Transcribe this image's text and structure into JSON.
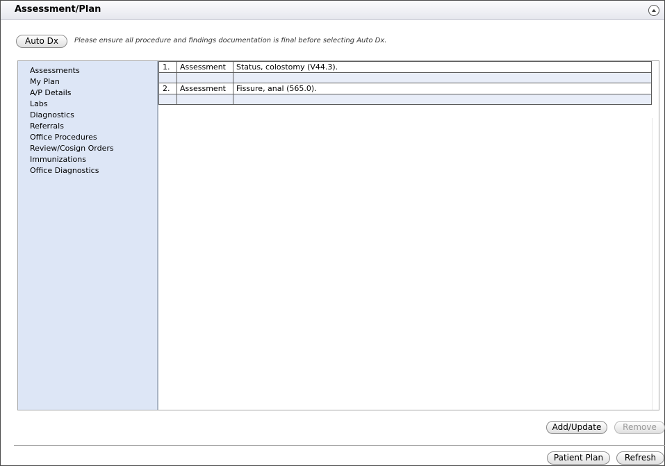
{
  "header": {
    "title": "Assessment/Plan",
    "collapse_icon": "chevron-up-circle-icon"
  },
  "toolbar": {
    "auto_dx_label": "Auto Dx",
    "note": "Please ensure all procedure and findings documentation is final before selecting Auto Dx."
  },
  "sidebar": {
    "items": [
      {
        "label": "Assessments"
      },
      {
        "label": "My Plan"
      },
      {
        "label": "A/P Details"
      },
      {
        "label": "Labs"
      },
      {
        "label": "Diagnostics"
      },
      {
        "label": "Referrals"
      },
      {
        "label": "Office Procedures"
      },
      {
        "label": "Review/Cosign Orders"
      },
      {
        "label": "Immunizations"
      },
      {
        "label": "Office Diagnostics"
      }
    ]
  },
  "assessments": {
    "rows": [
      {
        "num": "1.",
        "type": "Assessment",
        "desc": "Status, colostomy (V44.3)."
      },
      {
        "num": "2.",
        "type": "Assessment",
        "desc": "Fissure, anal (565.0)."
      }
    ]
  },
  "actions": {
    "add_update_label": "Add/Update",
    "remove_label": "Remove",
    "patient_plan_label": "Patient Plan",
    "refresh_label": "Refresh"
  }
}
